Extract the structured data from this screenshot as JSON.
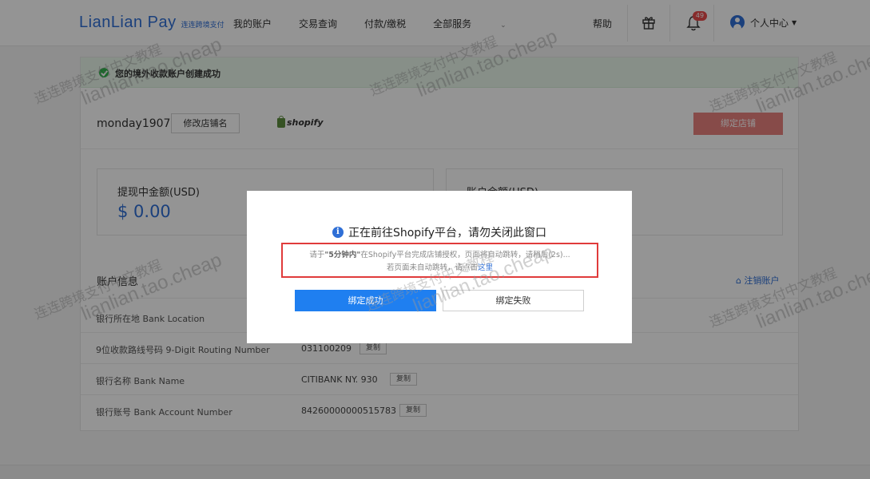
{
  "header": {
    "logo_text": "LianLian Pay",
    "logo_sub": "连连跨境支付",
    "nav": [
      {
        "label": "我的账户"
      },
      {
        "label": "交易查询"
      },
      {
        "label": "付款/缴税"
      },
      {
        "label": "全部服务"
      }
    ],
    "help_label": "帮助",
    "notification_count": "49",
    "user_label": "个人中心"
  },
  "success_banner": {
    "text": "您的境外收款账户创建成功"
  },
  "store": {
    "name": "monday1907",
    "rename_label": "修改店铺名",
    "platform_label": "shopify",
    "bind_label": "绑定店铺"
  },
  "balances": [
    {
      "label": "提现中金额(USD)",
      "value": "$ 0.00"
    },
    {
      "label": "账户余额(USD)",
      "value": ""
    }
  ],
  "account_info": {
    "title": "账户信息",
    "cancel_label": "注销账户",
    "copy_label": "复制",
    "rows": [
      {
        "label": "银行所在地  Bank Location",
        "value": ""
      },
      {
        "label": "9位收款路线号码  9-Digit Routing Number",
        "value": "031100209"
      },
      {
        "label": "银行名称  Bank Name",
        "value": "CITIBANK NY. 930"
      },
      {
        "label": "银行账号  Bank Account Number",
        "value": "84260000000515783"
      }
    ]
  },
  "modal": {
    "title": "正在前往Shopify平台，请勿关闭此窗口",
    "notice_prefix": "请于",
    "notice_bold": "\"5分钟内\"",
    "notice_rest": "在Shopify平台完成店铺授权，页面将自动跳转，请稍后(2s)...",
    "notice_line2_prefix": "若页面未自动跳转，请点击",
    "notice_link": "这里",
    "ok_label": "绑定成功",
    "fail_label": "绑定失败"
  },
  "watermark": {
    "cn": "连连跨境支付中文教程",
    "en": "lianlian.tao.cheap"
  },
  "colors": {
    "brand": "#2f6fd6",
    "success": "#2fb34a",
    "danger_border": "#e03b3b",
    "primary_button": "#1f7ff0",
    "bind_button": "#e8817f"
  }
}
